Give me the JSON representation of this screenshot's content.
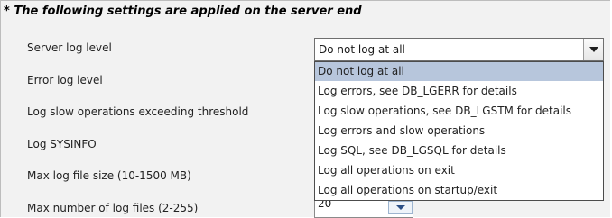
{
  "section": {
    "header": "* The following settings are applied on the server end"
  },
  "settings": {
    "server_log_level": "Server log level",
    "error_log_level": "Error log level",
    "log_slow_ops": "Log slow operations exceeding threshold",
    "log_sysinfo": "Log SYSINFO",
    "max_log_file_size": "Max log file size (10-1500 MB)",
    "max_log_files": "Max number of log files (2-255)"
  },
  "server_log_select": {
    "value": "Do not log at all",
    "options": [
      "Do not log at all",
      "Log errors, see DB_LGERR for details",
      "Log slow operations, see DB_LGSTM for details",
      "Log errors and slow operations",
      "Log SQL, see DB_LGSQL for details",
      "Log all operations on exit",
      "Log all operations on startup/exit"
    ],
    "highlighted_index": 0
  },
  "max_log_files_field": {
    "value": "20"
  },
  "colors": {
    "highlight": "#b7c6dc",
    "panel": "#f2f2f2"
  }
}
